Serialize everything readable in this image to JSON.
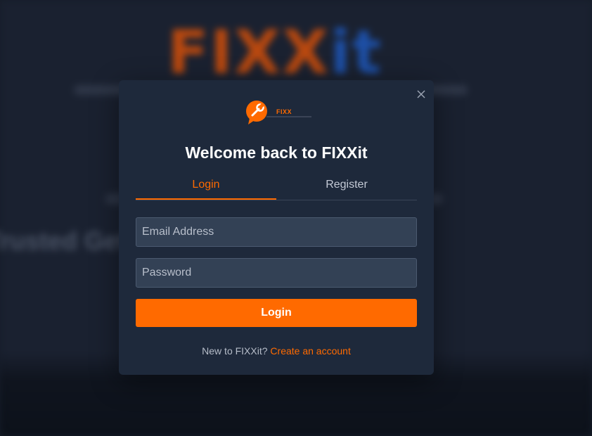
{
  "background": {
    "logo_part1": "FIXX",
    "logo_part2": "it",
    "tagline": "",
    "headline": "Trusted                             Get It Done"
  },
  "modal": {
    "logo_text": "FIXX",
    "title": "Welcome back to FIXXit",
    "tabs": [
      {
        "label": "Login",
        "active": true
      },
      {
        "label": "Register",
        "active": false
      }
    ],
    "email_placeholder": "Email Address",
    "password_placeholder": "Password",
    "login_button": "Login",
    "footer_text": "New to FIXXit?",
    "footer_link": "Create an account",
    "close_icon": "close-icon"
  },
  "colors": {
    "accent": "#ff6a00",
    "modal_bg": "#1e293b",
    "input_bg": "#334155"
  }
}
